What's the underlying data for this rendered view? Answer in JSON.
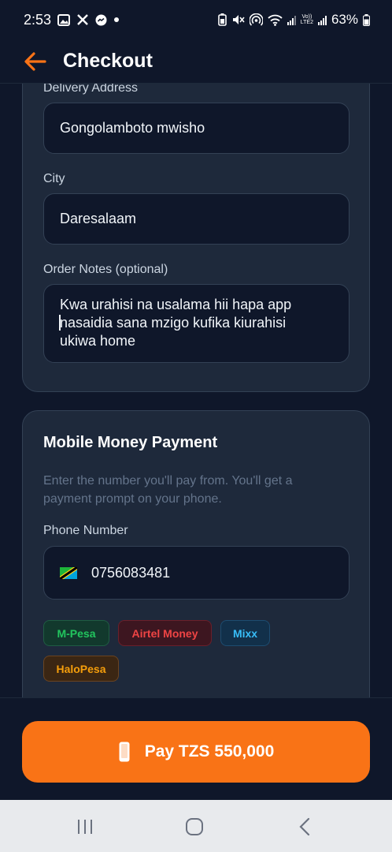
{
  "status_bar": {
    "time": "2:53",
    "battery": "63%",
    "volte_label_top": "Vo))",
    "volte_label_bottom": "LTE2"
  },
  "header": {
    "title": "Checkout"
  },
  "address_card": {
    "delivery_label": "Delivery Address",
    "delivery_value": "Gongolamboto mwisho",
    "city_label": "City",
    "city_value": "Daresalaam",
    "notes_label": "Order Notes (optional)",
    "notes_value": "Kwa urahisi na usalama hii hapa app\nnasaidia sana mzigo kufika kiurahisi\nukiwa home"
  },
  "payment_card": {
    "title": "Mobile Money Payment",
    "helper": "Enter the number you'll pay from. You'll get a payment prompt on your phone.",
    "phone_label": "Phone Number",
    "phone_value": "0756083481",
    "providers": [
      "M-Pesa",
      "Airtel Money",
      "Mixx",
      "HaloPesa"
    ]
  },
  "pay_button": {
    "label": "Pay TZS 550,000"
  },
  "colors": {
    "background": "#0f172a",
    "card": "#1e293b",
    "accent": "#f97316",
    "mpesa": "#22c55e",
    "airtel": "#ef4444",
    "mixx": "#38bdf8",
    "halopesa": "#f59e0b"
  },
  "icons": {
    "back": "arrow-left-icon",
    "phone": "phone-icon",
    "flag": "tanzania-flag-icon"
  }
}
